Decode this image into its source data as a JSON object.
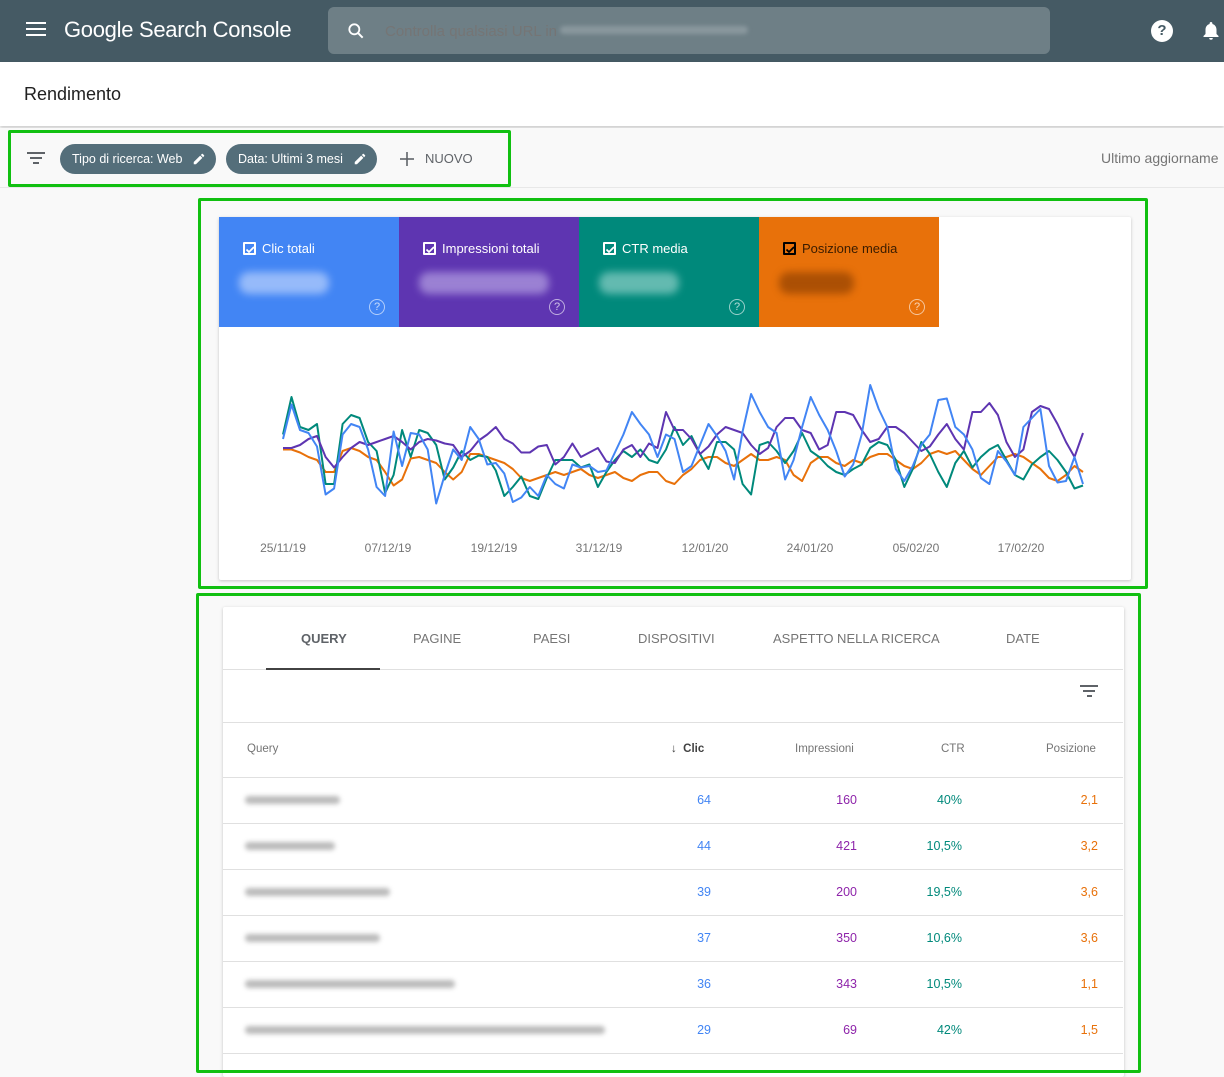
{
  "app": {
    "title_google": "Google",
    "title_product": "Search Console",
    "search_placeholder": "Controlla qualsiasi URL in",
    "icons": {
      "menu": "menu-icon",
      "search": "search-icon",
      "help": "help-icon",
      "notifications": "bell-icon"
    }
  },
  "page": {
    "title": "Rendimento"
  },
  "filters": {
    "chips": [
      {
        "label": "Tipo di ricerca: Web"
      },
      {
        "label": "Data: Ultimi 3 mesi"
      }
    ],
    "new_label": "NUOVO",
    "last_update": "Ultimo aggiorname"
  },
  "metrics": [
    {
      "label": "Clic totali",
      "color": "#4285f4",
      "checked": true,
      "help": "?"
    },
    {
      "label": "Impressioni totali",
      "color": "#5e35b1",
      "checked": true,
      "help": "?"
    },
    {
      "label": "CTR media",
      "color": "#00897b",
      "checked": true,
      "help": "?"
    },
    {
      "label": "Posizione media",
      "color": "#e8710a",
      "checked": true,
      "help": "?"
    }
  ],
  "chart_data": {
    "type": "line",
    "title": "",
    "xlabel": "",
    "ylabel": "",
    "x_ticks": [
      "25/11/19",
      "07/12/19",
      "19/12/19",
      "31/12/19",
      "12/01/20",
      "24/01/20",
      "05/02/20",
      "17/02/20"
    ],
    "x_range": [
      "25/11/19",
      "24/02/20"
    ],
    "y_axis_shown": false,
    "y_range_normalized": [
      0,
      100
    ],
    "grid": false,
    "series": [
      {
        "name": "Clic totali",
        "color": "#4285f4",
        "values": [
          52,
          75,
          58,
          56,
          47,
          15,
          19,
          55,
          62,
          60,
          45,
          20,
          14,
          57,
          34,
          56,
          55,
          45,
          9,
          28,
          45,
          38,
          60,
          52,
          35,
          36,
          29,
          10,
          13,
          20,
          14,
          28,
          22,
          19,
          35,
          33,
          34,
          30,
          31,
          43,
          55,
          70,
          62,
          55,
          40,
          55,
          52,
          30,
          34,
          48,
          62,
          54,
          44,
          25,
          57,
          82,
          70,
          60,
          56,
          25,
          38,
          60,
          80,
          68,
          58,
          44,
          27,
          35,
          55,
          88,
          72,
          60,
          32,
          24,
          34,
          48,
          55,
          78,
          79,
          60,
          55,
          45,
          26,
          22,
          44,
          37,
          28,
          60,
          66,
          72,
          34,
          23,
          24,
          40,
          22
        ]
      },
      {
        "name": "Impressioni totali",
        "color": "#5e35b1",
        "values": [
          46,
          46,
          48,
          52,
          54,
          40,
          33,
          40,
          46,
          50,
          48,
          50,
          52,
          54,
          50,
          45,
          50,
          52,
          51,
          49,
          48,
          40,
          44,
          51,
          55,
          60,
          52,
          49,
          43,
          43,
          47,
          48,
          35,
          40,
          49,
          40,
          43,
          46,
          37,
          36,
          45,
          48,
          40,
          49,
          46,
          70,
          58,
          58,
          52,
          42,
          47,
          55,
          60,
          58,
          56,
          48,
          42,
          46,
          60,
          66,
          66,
          58,
          56,
          45,
          48,
          70,
          70,
          68,
          58,
          50,
          52,
          60,
          60,
          56,
          50,
          44,
          47,
          55,
          62,
          52,
          45,
          70,
          70,
          76,
          68,
          50,
          40,
          45,
          70,
          74,
          72,
          62,
          50,
          40,
          56
        ]
      },
      {
        "name": "CTR media",
        "color": "#00897b",
        "values": [
          55,
          80,
          60,
          58,
          62,
          22,
          22,
          62,
          68,
          66,
          50,
          44,
          16,
          28,
          58,
          40,
          58,
          56,
          48,
          25,
          33,
          44,
          38,
          41,
          40,
          31,
          14,
          20,
          27,
          14,
          12,
          26,
          38,
          38,
          38,
          33,
          35,
          20,
          30,
          38,
          44,
          40,
          45,
          38,
          36,
          45,
          60,
          48,
          54,
          42,
          32,
          50,
          50,
          45,
          22,
          15,
          48,
          50,
          44,
          36,
          44,
          56,
          44,
          40,
          34,
          30,
          28,
          32,
          35,
          46,
          50,
          48,
          38,
          20,
          32,
          50,
          42,
          30,
          20,
          36,
          44,
          33,
          40,
          45,
          48,
          38,
          28,
          25,
          35,
          40,
          44,
          38,
          30,
          19,
          21
        ]
      },
      {
        "name": "Posizione media",
        "color": "#e8710a",
        "values": [
          45,
          45,
          43,
          40,
          38,
          30,
          30,
          44,
          46,
          44,
          40,
          38,
          30,
          21,
          25,
          39,
          40,
          38,
          36,
          30,
          25,
          30,
          42,
          42,
          40,
          38,
          36,
          32,
          26,
          24,
          26,
          28,
          30,
          28,
          30,
          32,
          28,
          26,
          28,
          30,
          26,
          24,
          28,
          30,
          30,
          24,
          22,
          28,
          32,
          38,
          40,
          40,
          36,
          34,
          38,
          42,
          38,
          38,
          40,
          38,
          28,
          24,
          36,
          40,
          40,
          36,
          34,
          38,
          36,
          40,
          42,
          42,
          38,
          34,
          32,
          36,
          42,
          44,
          42,
          44,
          38,
          32,
          28,
          34,
          40,
          40,
          42,
          40,
          36,
          32,
          26,
          24,
          28,
          34,
          30
        ]
      }
    ]
  },
  "table": {
    "tabs": [
      "QUERY",
      "PAGINE",
      "PAESI",
      "DISPOSITIVI",
      "ASPETTO NELLA RICERCA",
      "DATE"
    ],
    "active_tab": "QUERY",
    "columns": {
      "query": "Query",
      "clicks": "Clic",
      "impressions": "Impressioni",
      "ctr": "CTR",
      "position": "Posizione"
    },
    "sort_indicator": "↓",
    "rows": [
      {
        "clicks": "64",
        "impressions": "160",
        "ctr": "40%",
        "position": "2,1"
      },
      {
        "clicks": "44",
        "impressions": "421",
        "ctr": "10,5%",
        "position": "3,2"
      },
      {
        "clicks": "39",
        "impressions": "200",
        "ctr": "19,5%",
        "position": "3,6"
      },
      {
        "clicks": "37",
        "impressions": "350",
        "ctr": "10,6%",
        "position": "3,6"
      },
      {
        "clicks": "36",
        "impressions": "343",
        "ctr": "10,5%",
        "position": "1,1"
      },
      {
        "clicks": "29",
        "impressions": "69",
        "ctr": "42%",
        "position": "1,5"
      }
    ]
  }
}
